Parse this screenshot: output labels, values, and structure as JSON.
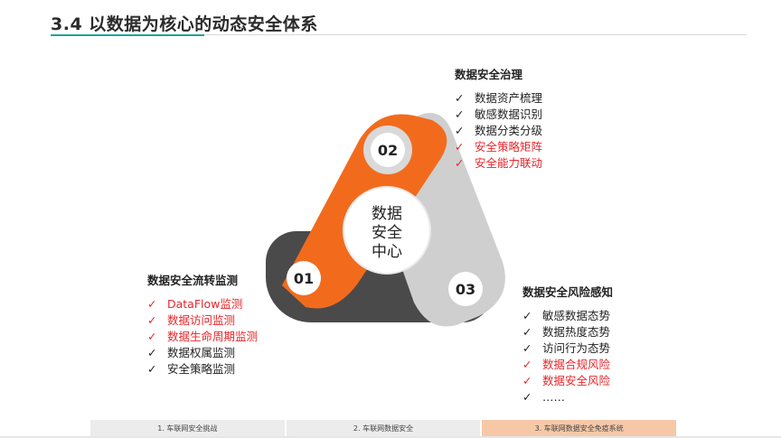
{
  "title": "3.4 以数据为核心的动态安全体系",
  "center": {
    "lines": [
      "数据",
      "安全",
      "中心"
    ]
  },
  "badges": [
    "02",
    "01",
    "03"
  ],
  "colors": {
    "orange": "#f26b1d",
    "gray": "#cfcfcf",
    "dark": "#4a4a4a",
    "red": "#e8262b",
    "accent": "#1fa39a"
  },
  "blocks": {
    "governance": {
      "heading": "数据安全治理",
      "items": [
        {
          "text": "数据资产梳理",
          "highlight": false
        },
        {
          "text": "敏感数据识别",
          "highlight": false
        },
        {
          "text": "数据分类分级",
          "highlight": false
        },
        {
          "text": "安全策略矩阵",
          "highlight": true
        },
        {
          "text": "安全能力联动",
          "highlight": true
        }
      ]
    },
    "flow": {
      "heading": "数据安全流转监测",
      "items": [
        {
          "text": "DataFlow监测",
          "highlight": true
        },
        {
          "text": "数据访问监测",
          "highlight": true
        },
        {
          "text": "数据生命周期监测",
          "highlight": true
        },
        {
          "text": "数据权属监测",
          "highlight": false
        },
        {
          "text": "安全策略监测",
          "highlight": false
        }
      ]
    },
    "risk": {
      "heading": "数据安全风险感知",
      "items": [
        {
          "text": "敏感数据态势",
          "highlight": false
        },
        {
          "text": "数据热度态势",
          "highlight": false
        },
        {
          "text": "访问行为态势",
          "highlight": false
        },
        {
          "text": "数据合规风险",
          "highlight": true
        },
        {
          "text": "数据安全风险",
          "highlight": true
        },
        {
          "text": "……",
          "highlight": false
        }
      ]
    }
  },
  "check_mark": "✓",
  "footer": {
    "tabs": [
      "1. 车联网安全挑战",
      "2. 车联网数据安全",
      "3. 车联网数据安全免疫系统"
    ],
    "active_index": 2
  }
}
